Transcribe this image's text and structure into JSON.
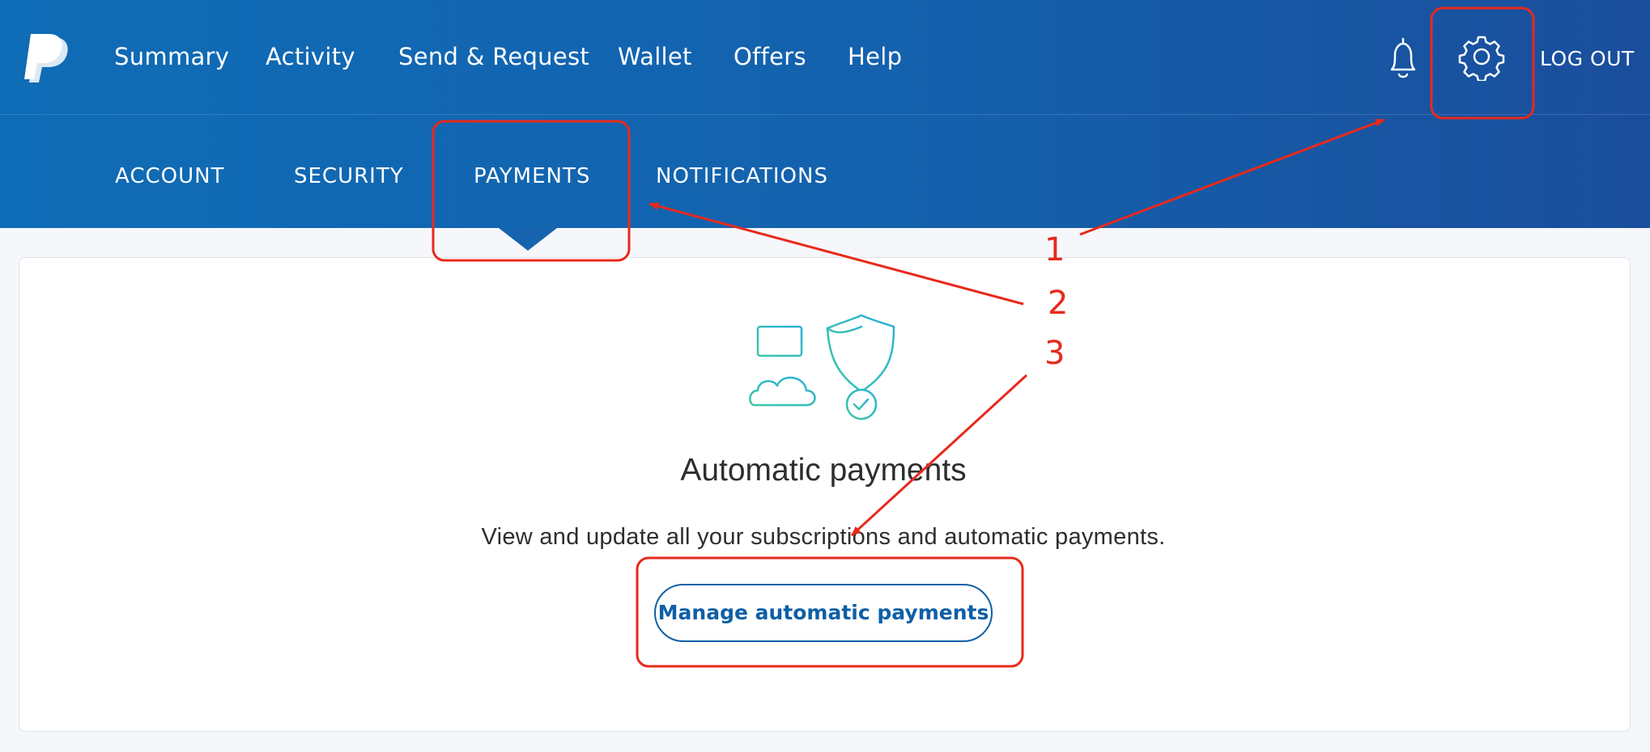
{
  "topnav": {
    "items": [
      {
        "label": "Summary"
      },
      {
        "label": "Activity"
      },
      {
        "label": "Send & Request"
      },
      {
        "label": "Wallet"
      },
      {
        "label": "Offers"
      },
      {
        "label": "Help"
      }
    ],
    "logout_label": "LOG OUT"
  },
  "subnav": {
    "items": [
      {
        "label": "ACCOUNT"
      },
      {
        "label": "SECURITY"
      },
      {
        "label": "PAYMENTS"
      },
      {
        "label": "NOTIFICATIONS"
      }
    ],
    "active": "PAYMENTS"
  },
  "main": {
    "title": "Automatic payments",
    "description": "View and update all your subscriptions and automatic payments.",
    "button_label": "Manage automatic payments"
  },
  "annotations": {
    "step1": "1",
    "step2": "2",
    "step3": "3"
  },
  "icons": [
    "paypal-logo",
    "bell-icon",
    "gear-icon",
    "card-cloud-shield-icon"
  ],
  "colors": {
    "header_start": "#0f6cb6",
    "header_end": "#1a4e9c",
    "button_blue": "#0f5fa6",
    "illustration_teal": "#2ec4b6",
    "annotation_red": "#e8291c"
  }
}
